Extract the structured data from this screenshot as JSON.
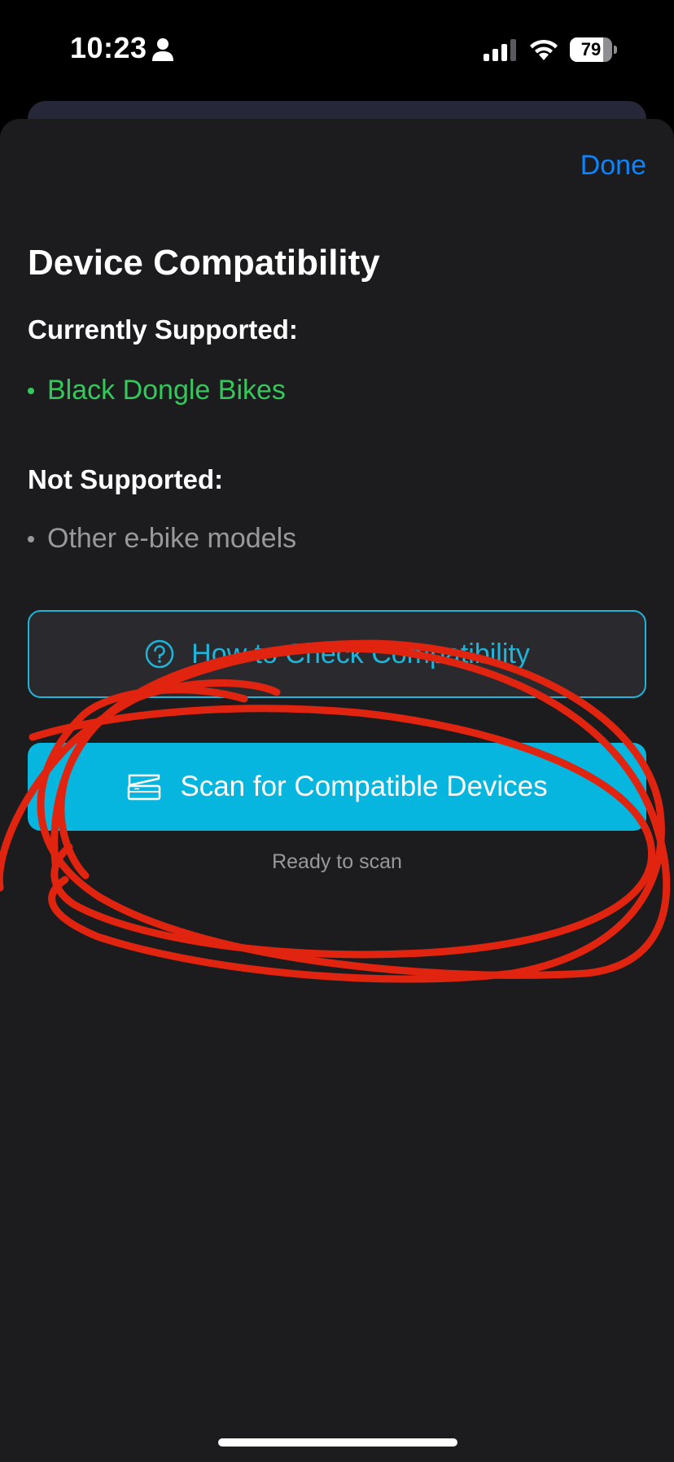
{
  "status_bar": {
    "time": "10:23",
    "battery_percent": "79",
    "battery_level": 0.79,
    "icons": [
      "person-icon",
      "cellular-signal-icon",
      "wifi-icon",
      "battery-icon"
    ]
  },
  "sheet": {
    "done_label": "Done",
    "title": "Device Compatibility",
    "supported": {
      "heading": "Currently Supported:",
      "items": [
        "Black Dongle Bikes"
      ],
      "color": "#34c759"
    },
    "not_supported": {
      "heading": "Not Supported:",
      "items": [
        "Other e-bike models"
      ],
      "color": "#98989d"
    },
    "check_button": {
      "label": "How to Check Compatibility",
      "icon": "question-circle-icon",
      "color": "#1fb4d9"
    },
    "scan_button": {
      "label": "Scan for Compatible Devices",
      "icon": "scanner-icon",
      "color": "#07b6de"
    },
    "scan_status": "Ready to scan"
  },
  "annotation": {
    "kind": "hand-drawn red circle around scan button",
    "color": "#e0240f"
  },
  "colors": {
    "accent_link": "#0a84ff",
    "sheet_background": "#1c1c1e"
  }
}
